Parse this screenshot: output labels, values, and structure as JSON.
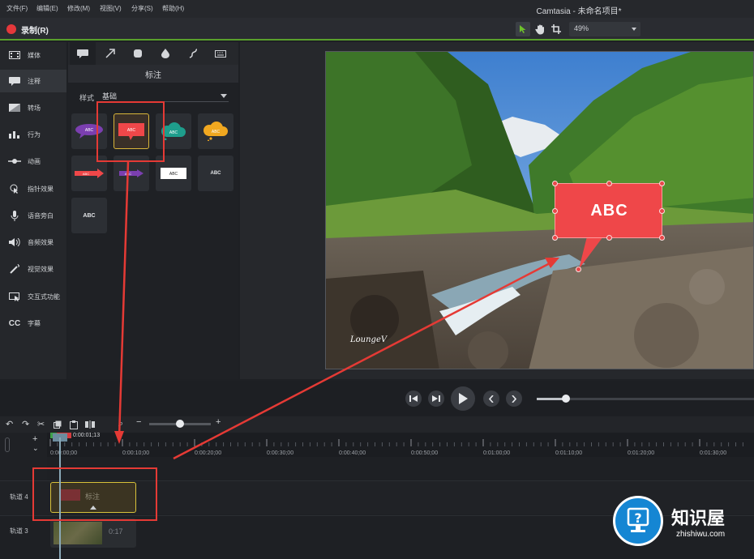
{
  "menu": [
    "文件(F)",
    "编辑(E)",
    "修改(M)",
    "视图(V)",
    "分享(S)",
    "帮助(H)"
  ],
  "app_title": "Camtasia - 未命名项目*",
  "toolbar": {
    "record_label": "录制(R)",
    "zoom_value": "49%",
    "icons": [
      "pointer-icon",
      "hand-icon",
      "crop-icon"
    ]
  },
  "sidebar": {
    "items": [
      {
        "label": "媒体",
        "icon": "media-icon"
      },
      {
        "label": "注释",
        "icon": "annotation-icon"
      },
      {
        "label": "转场",
        "icon": "transition-icon"
      },
      {
        "label": "行为",
        "icon": "behavior-icon"
      },
      {
        "label": "动画",
        "icon": "animation-icon"
      },
      {
        "label": "指针效果",
        "icon": "cursor-effect-icon"
      },
      {
        "label": "语音旁白",
        "icon": "microphone-icon"
      },
      {
        "label": "音频效果",
        "icon": "audio-effect-icon"
      },
      {
        "label": "视觉效果",
        "icon": "wand-icon"
      },
      {
        "label": "交互式功能",
        "icon": "interactive-icon"
      },
      {
        "label": "字幕",
        "icon": "cc-icon"
      }
    ],
    "active_index": 1
  },
  "panel": {
    "title": "标注",
    "style_label": "样式",
    "style_value": "基础",
    "tabs": [
      "callout-tab-icon",
      "arrow-tab-icon",
      "shape-tab-icon",
      "blur-tab-icon",
      "sketch-tab-icon",
      "keyboard-tab-icon"
    ],
    "tile_text": "ABC"
  },
  "canvas": {
    "video_watermark": "LoungeV",
    "callout_text": "ABC",
    "callout_color": "#ef4749"
  },
  "timeline": {
    "time_readout": "0:00:01;13",
    "ticks": [
      "0:00:00;00",
      "0:00:10;00",
      "0:00:20;00",
      "0:00:30;00",
      "0:00:40;00",
      "0:00:50;00",
      "0:01:00;00",
      "0:01:10;00",
      "0:01:20;00",
      "0:01:30;00"
    ],
    "tracks": [
      {
        "label": "轨道 4",
        "clip_label": "标注"
      },
      {
        "label": "轨道 3",
        "clip_label": "0:17"
      }
    ]
  },
  "brand": {
    "title": "知识屋",
    "url": "zhishiwu.com"
  },
  "colors": {
    "accent_green": "#5aa02c",
    "highlight_red": "#e53a35",
    "brand_blue": "#1586d3"
  }
}
